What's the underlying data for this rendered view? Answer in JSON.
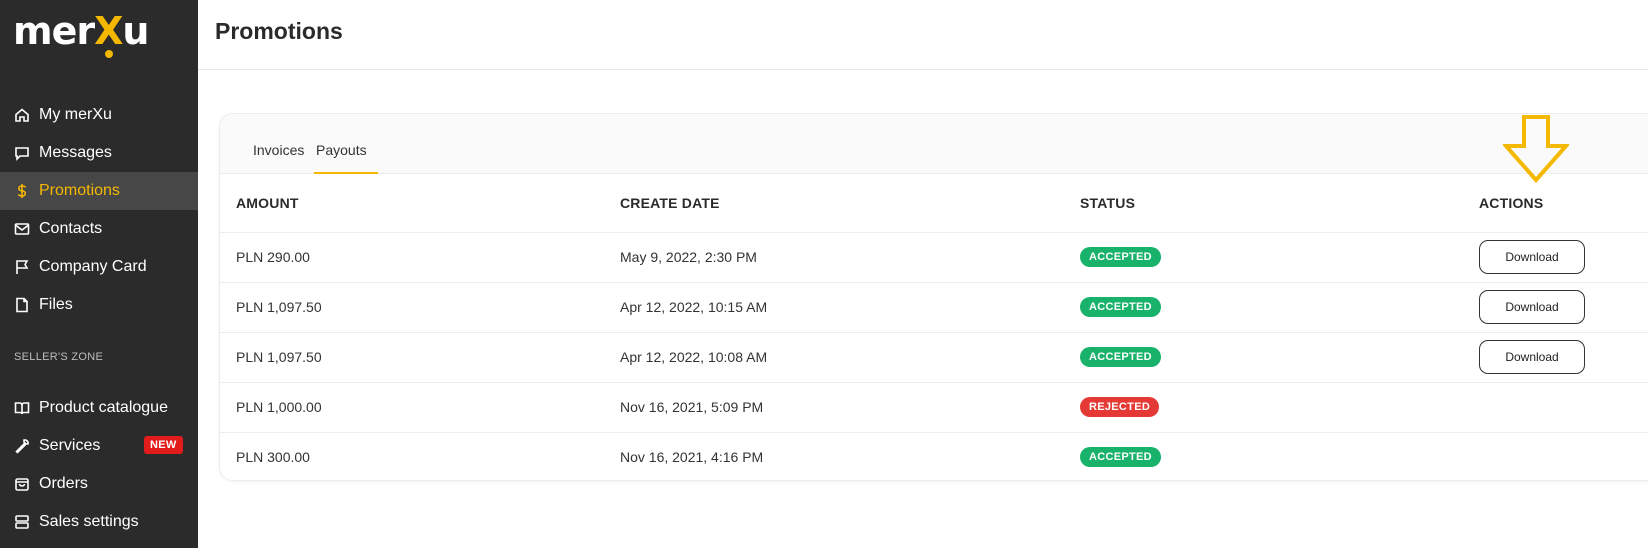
{
  "brand": {
    "logo_pre": "mer",
    "logo_x": "X",
    "logo_post": "u",
    "accent": "#f5b800"
  },
  "sidebar": {
    "items": [
      {
        "label": "My merXu",
        "icon": "home-icon"
      },
      {
        "label": "Messages",
        "icon": "chat-icon"
      },
      {
        "label": "Promotions",
        "icon": "dollar-icon",
        "active": true
      },
      {
        "label": "Contacts",
        "icon": "mail-icon"
      },
      {
        "label": "Company Card",
        "icon": "flag-icon"
      },
      {
        "label": "Files",
        "icon": "file-icon"
      }
    ],
    "section_label": "SELLER'S ZONE",
    "seller_items": [
      {
        "label": "Product catalogue",
        "icon": "book-icon"
      },
      {
        "label": "Services",
        "icon": "wrench-icon",
        "badge": "NEW"
      },
      {
        "label": "Orders",
        "icon": "bag-icon"
      },
      {
        "label": "Sales settings",
        "icon": "server-icon"
      }
    ]
  },
  "page": {
    "title": "Promotions"
  },
  "tabs": [
    {
      "label": "Invoices"
    },
    {
      "label": "Payouts",
      "active": true
    }
  ],
  "table": {
    "columns": [
      "AMOUNT",
      "CREATE DATE",
      "STATUS",
      "ACTIONS"
    ],
    "rows": [
      {
        "amount": "PLN 290.00",
        "date": "May 9, 2022, 2:30 PM",
        "status": "ACCEPTED",
        "action": "Download"
      },
      {
        "amount": "PLN 1,097.50",
        "date": "Apr 12, 2022, 10:15 AM",
        "status": "ACCEPTED",
        "action": "Download"
      },
      {
        "amount": "PLN 1,097.50",
        "date": "Apr 12, 2022, 10:08 AM",
        "status": "ACCEPTED",
        "action": "Download"
      },
      {
        "amount": "PLN 1,000.00",
        "date": "Nov 16, 2021, 5:09 PM",
        "status": "REJECTED",
        "action": ""
      },
      {
        "amount": "PLN 300.00",
        "date": "Nov 16, 2021, 4:16 PM",
        "status": "ACCEPTED",
        "action": ""
      }
    ]
  },
  "colors": {
    "accepted": "#19b26b",
    "rejected": "#e53935",
    "sidebar_bg": "#2b2b2b"
  },
  "annotation": {
    "icon": "arrow-down-icon",
    "color": "#f5b800"
  }
}
